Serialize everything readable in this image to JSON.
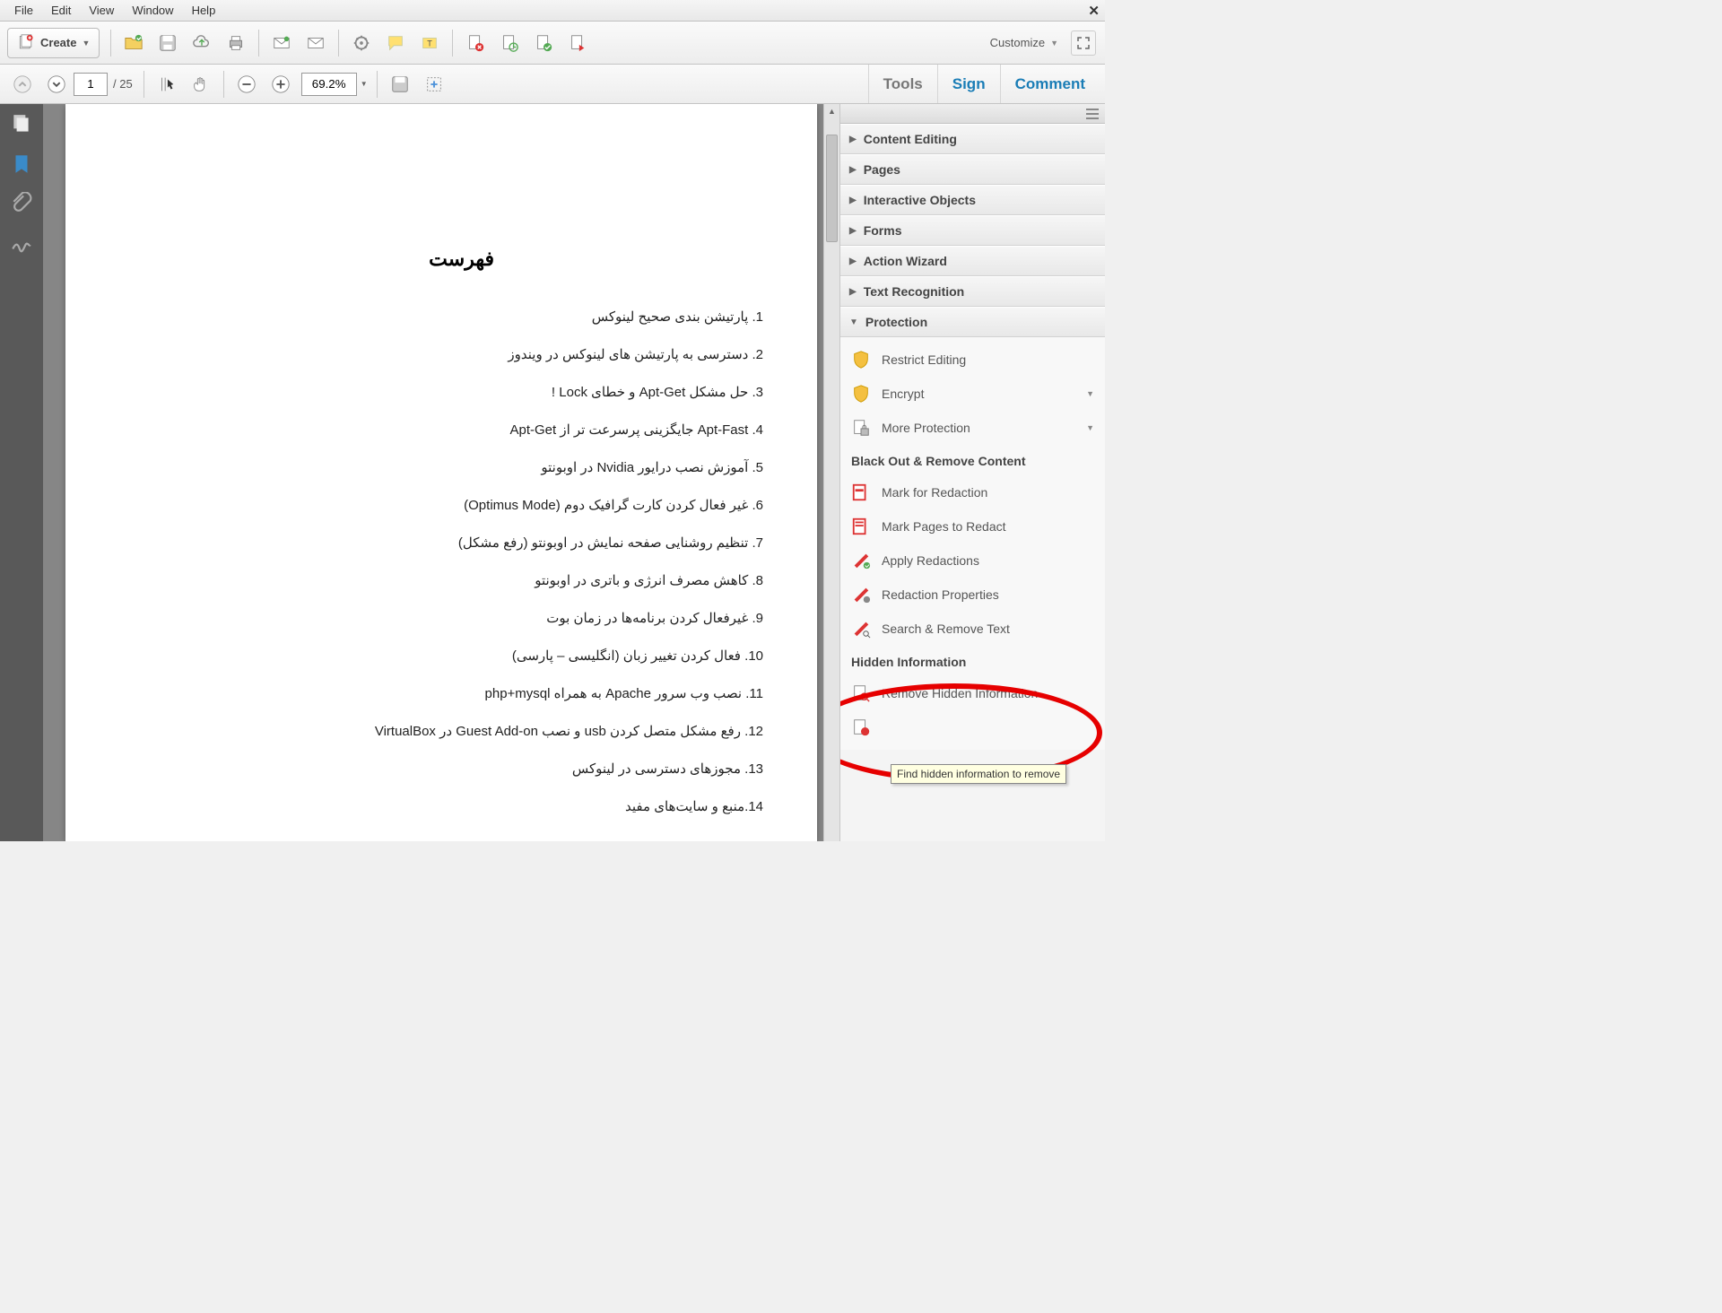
{
  "menubar": {
    "items": [
      "File",
      "Edit",
      "View",
      "Window",
      "Help"
    ]
  },
  "toolbar1": {
    "create_label": "Create",
    "customize_label": "Customize"
  },
  "toolbar2": {
    "page_current": "1",
    "page_total": "/ 25",
    "zoom": "69.2%"
  },
  "right_tabs": {
    "tools": "Tools",
    "sign": "Sign",
    "comment": "Comment"
  },
  "doc": {
    "title": "فهرست",
    "toc": [
      "1.   پارتیشن بندی صحیح  لینوکس",
      "2.   دسترسی به پارتیشن های لینوکس در ویندوز",
      "3.   حل مشکل Apt-Get و خطای Lock !",
      "4.   Apt-Fast جایگزینی پرسرعت تر از Apt-Get",
      "5.   آموزش نصب درایور Nvidia در اوبونتو",
      "6.   غیر فعال کردن کارت گرافیک دوم (Optimus Mode)",
      "7.   تنظیم روشنایی صفحه نمایش در اوبونتو (رفع مشکل)",
      "8.   کاهش مصرف انرژی و باتری در اوبونتو",
      "9.   غیرفعال کردن برنامه‌ها در زمان بوت",
      "10. فعال کردن تغییر زبان (انگلیسی – پارسی)",
      "11. نصب وب سرور Apache به همراه php+mysql",
      "12. رفع مشکل متصل کردن usb و نصب Guest Add-on در VirtualBox",
      "13. مجوزهای دسترسی در لینوکس",
      "14.منبع و سایت‌های مفید"
    ]
  },
  "rpanel": {
    "sections": {
      "content_editing": "Content Editing",
      "pages": "Pages",
      "interactive_objects": "Interactive Objects",
      "forms": "Forms",
      "action_wizard": "Action Wizard",
      "text_recognition": "Text Recognition",
      "protection": "Protection"
    },
    "protection_items": {
      "restrict": "Restrict Editing",
      "encrypt": "Encrypt",
      "more": "More Protection"
    },
    "blackout_header": "Black Out & Remove Content",
    "redact": {
      "mark": "Mark for Redaction",
      "mark_pages": "Mark Pages to Redact",
      "apply": "Apply Redactions",
      "props": "Redaction Properties",
      "search": "Search & Remove Text"
    },
    "hidden_header": "Hidden Information",
    "hidden": {
      "remove": "Remove Hidden Information"
    },
    "tooltip": "Find hidden information to remove"
  }
}
